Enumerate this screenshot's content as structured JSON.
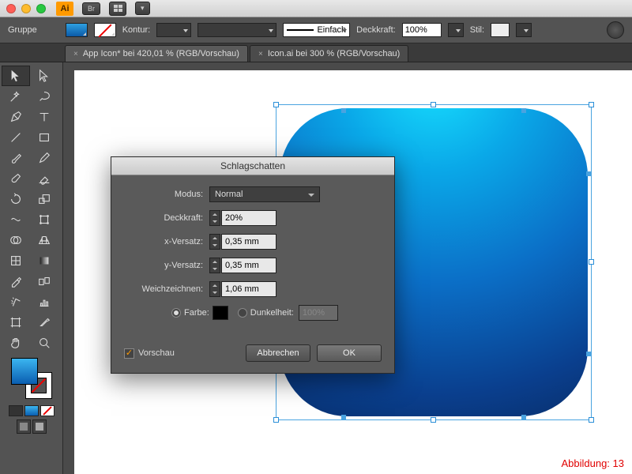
{
  "app": {
    "short": "Ai",
    "bridge": "Br"
  },
  "options": {
    "group_label": "Gruppe",
    "kontur_label": "Kontur:",
    "stroke_style": "Einfach",
    "deckkraft_label": "Deckkraft:",
    "deckkraft_value": "100%",
    "stil_label": "Stil:"
  },
  "tabs": [
    {
      "label": "App Icon* bei 420,01 % (RGB/Vorschau)",
      "active": true
    },
    {
      "label": "Icon.ai bei 300 % (RGB/Vorschau)",
      "active": false
    }
  ],
  "dialog": {
    "title": "Schlagschatten",
    "modus_label": "Modus:",
    "modus_value": "Normal",
    "deckkraft_label": "Deckkraft:",
    "deckkraft_value": "20%",
    "xversatz_label": "x-Versatz:",
    "xversatz_value": "0,35 mm",
    "yversatz_label": "y-Versatz:",
    "yversatz_value": "0,35 mm",
    "weichzeichnen_label": "Weichzeichnen:",
    "weichzeichnen_value": "1,06 mm",
    "farbe_label": "Farbe:",
    "dunkelheit_label": "Dunkelheit:",
    "dunkelheit_value": "100%",
    "vorschau_label": "Vorschau",
    "cancel": "Abbrechen",
    "ok": "OK"
  },
  "caption": "Abbildung: 13"
}
